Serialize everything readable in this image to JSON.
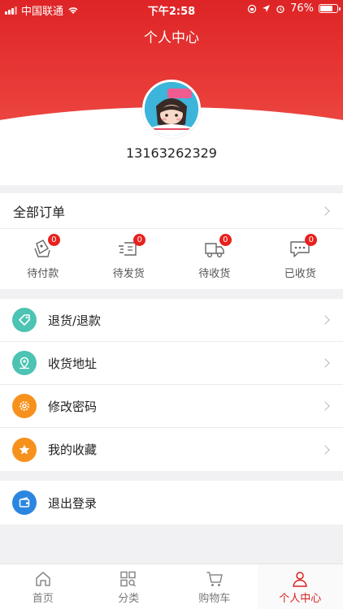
{
  "status_bar": {
    "carrier": "中国联通",
    "time": "下午2:58",
    "battery": "76%",
    "battery_level": 0.76
  },
  "header": {
    "title": "个人中心",
    "phone": "13163262329"
  },
  "orders": {
    "title": "全部订单",
    "items": [
      {
        "label": "待付款",
        "count": "0",
        "icon": "wallet-card-icon"
      },
      {
        "label": "待发货",
        "count": "0",
        "icon": "shipping-box-icon"
      },
      {
        "label": "待收货",
        "count": "0",
        "icon": "truck-icon"
      },
      {
        "label": "已收货",
        "count": "0",
        "icon": "chat-bubble-icon"
      }
    ]
  },
  "menu": {
    "items": [
      {
        "label": "退货/退款",
        "icon": "tag-icon",
        "color": "#4cc3b3"
      },
      {
        "label": "收货地址",
        "icon": "location-pin-icon",
        "color": "#4cc3b3"
      },
      {
        "label": "修改密码",
        "icon": "gear-icon",
        "color": "#f7911d"
      },
      {
        "label": "我的收藏",
        "icon": "star-icon",
        "color": "#f7911d"
      }
    ]
  },
  "logout": {
    "label": "退出登录",
    "icon": "wallet-icon",
    "color": "#2a86e0"
  },
  "tabbar": {
    "items": [
      {
        "label": "首页",
        "icon": "home-icon"
      },
      {
        "label": "分类",
        "icon": "grid-search-icon"
      },
      {
        "label": "购物车",
        "icon": "cart-icon"
      },
      {
        "label": "个人中心",
        "icon": "user-icon"
      }
    ],
    "active_color": "#d8201e"
  }
}
